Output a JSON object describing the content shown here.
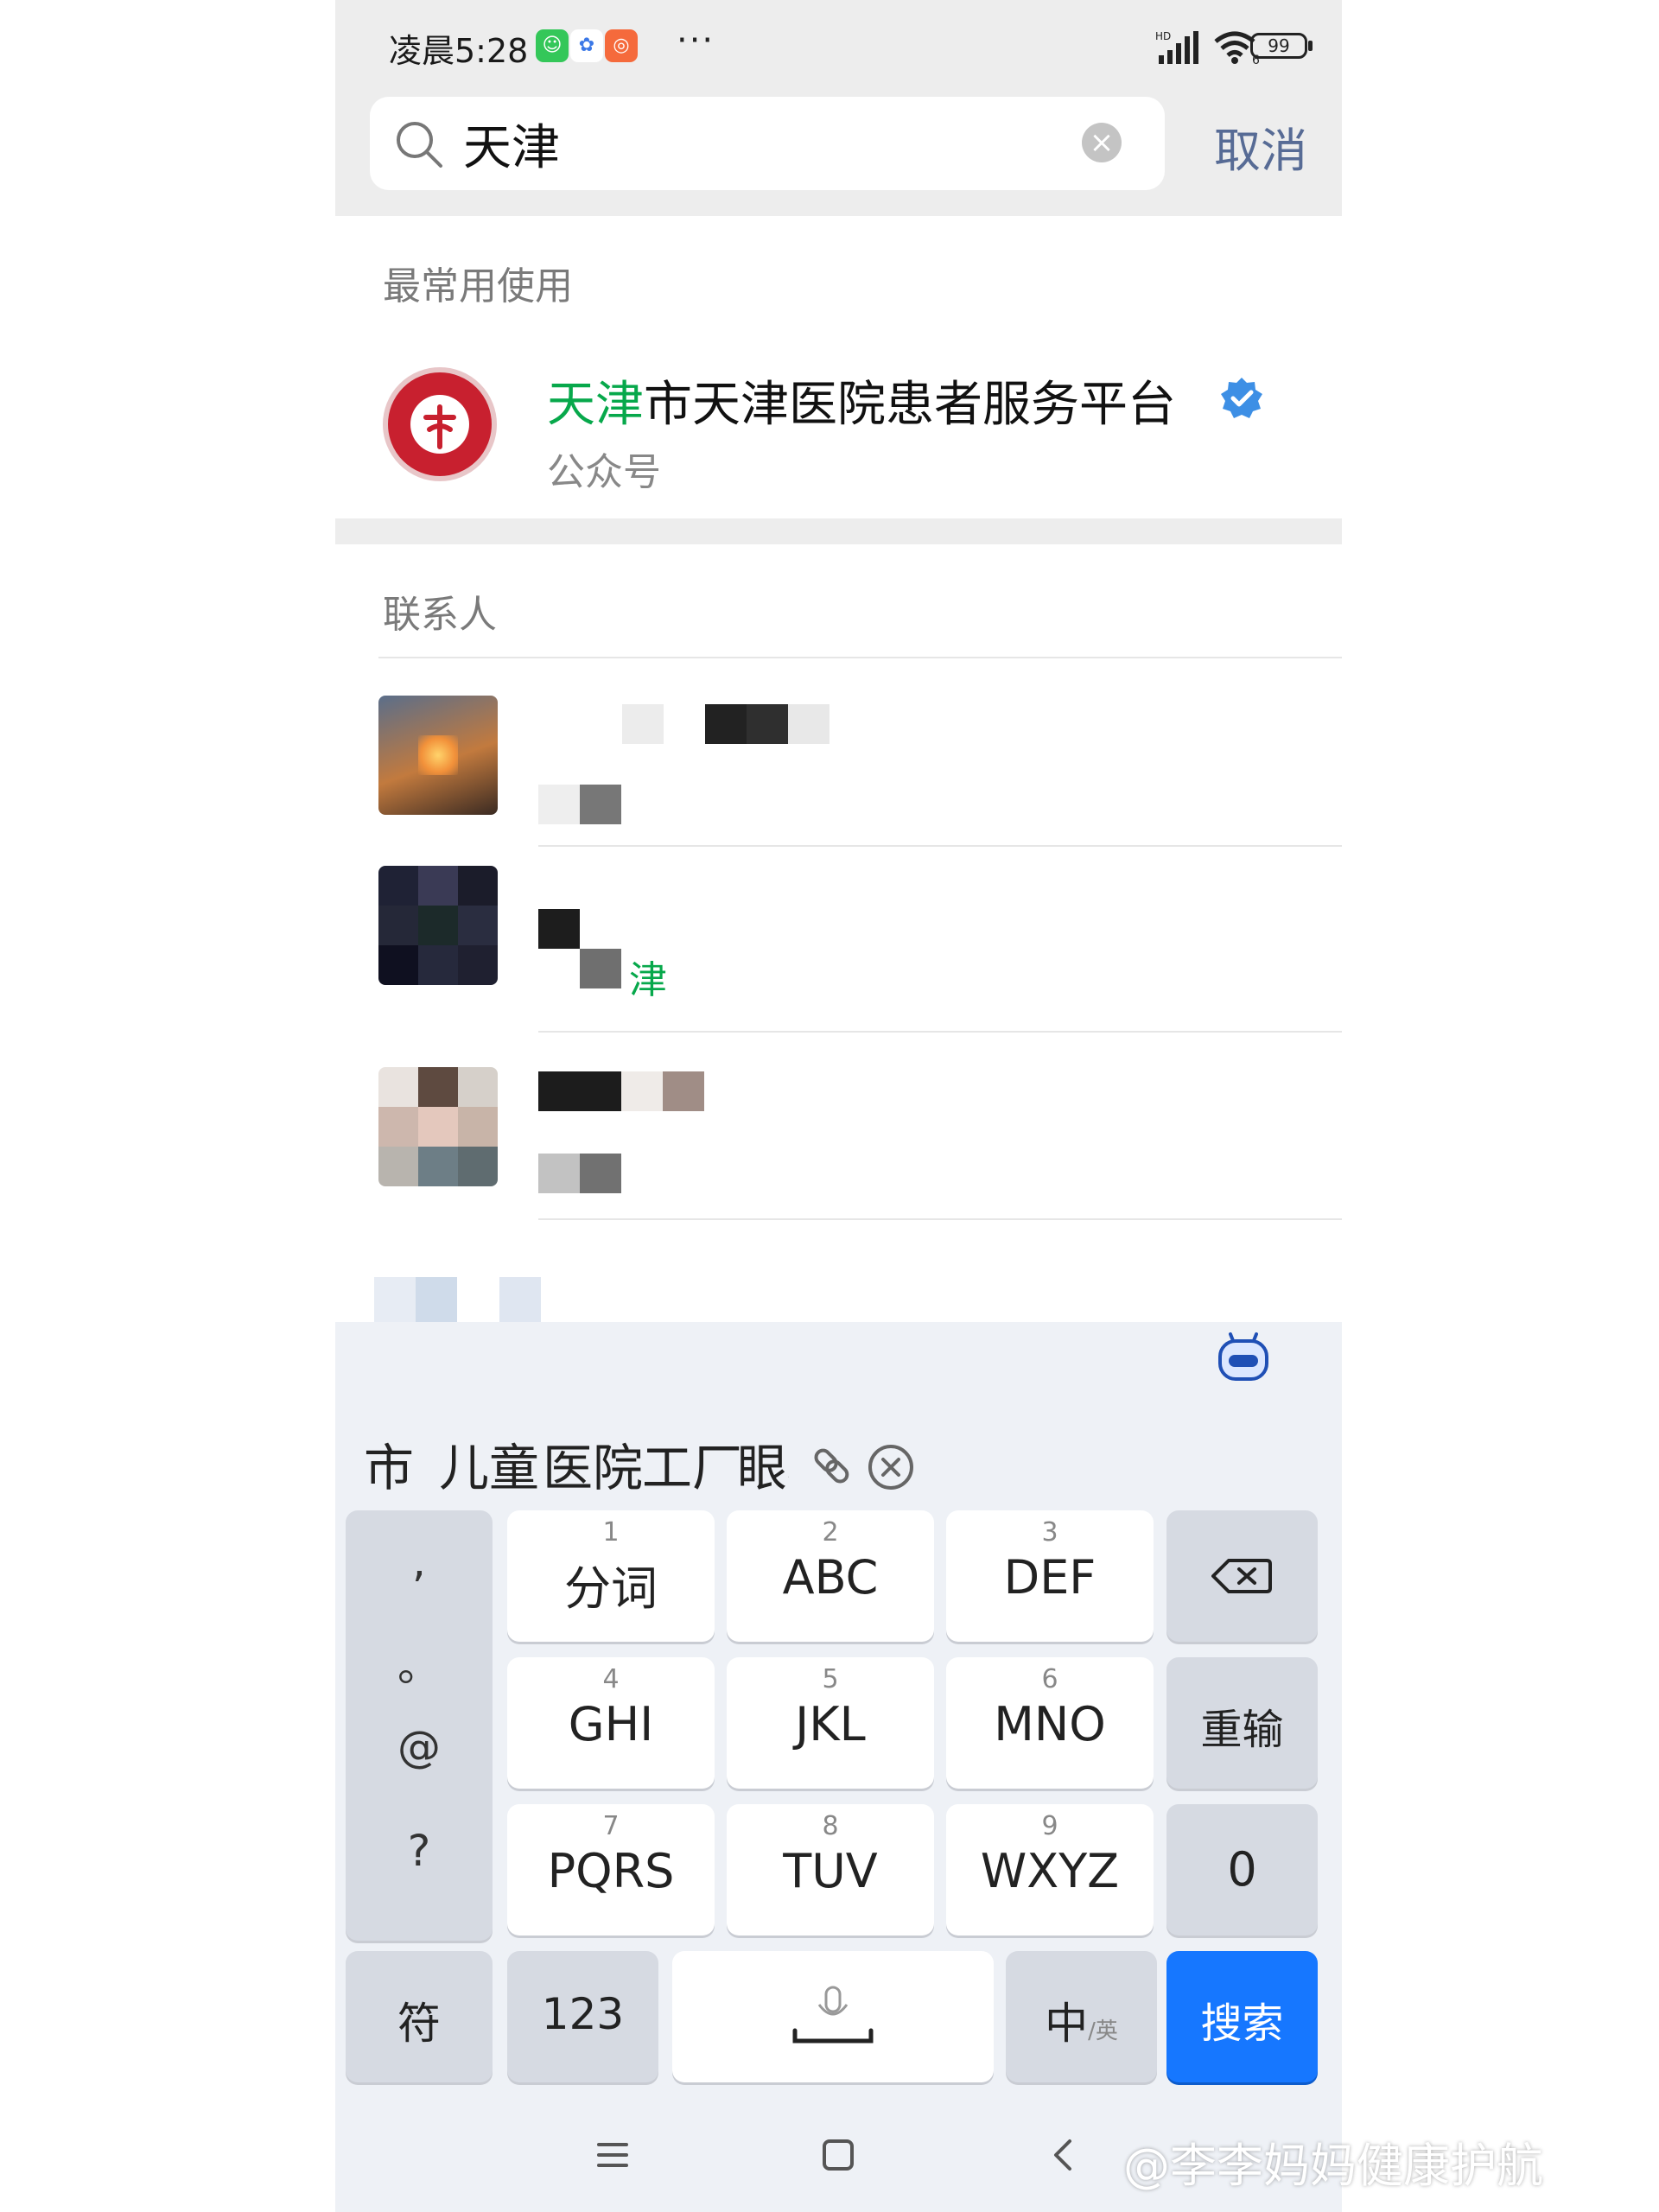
{
  "status_bar": {
    "time": "凌晨5:28",
    "network": "HD",
    "wifi_sub": "6",
    "battery": "99"
  },
  "search": {
    "query": "天津",
    "cancel_label": "取消"
  },
  "sections": {
    "most_used": "最常用使用",
    "contacts": "联系人"
  },
  "official_account": {
    "name_highlight": "天津",
    "name_rest": "市天津医院患者服务平台",
    "type": "公众号"
  },
  "contacts": [
    {
      "snippet": ""
    },
    {
      "snippet": "津"
    },
    {
      "snippet": ""
    }
  ],
  "keyboard": {
    "candidates": [
      "市",
      "儿童",
      "医院",
      "工厂",
      "眼科"
    ],
    "punct": [
      ",",
      "。",
      "@",
      "?"
    ],
    "keys": [
      {
        "num": "1",
        "label": "分词"
      },
      {
        "num": "2",
        "label": "ABC"
      },
      {
        "num": "3",
        "label": "DEF"
      },
      {
        "num": "4",
        "label": "GHI"
      },
      {
        "num": "5",
        "label": "JKL"
      },
      {
        "num": "6",
        "label": "MNO"
      },
      {
        "num": "7",
        "label": "PQRS"
      },
      {
        "num": "8",
        "label": "TUV"
      },
      {
        "num": "9",
        "label": "WXYZ"
      }
    ],
    "reenter_label": "重输",
    "zero_label": "0",
    "symbols_label": "符",
    "numbers_label": "123",
    "lang_label": "中",
    "lang_sub": "/英",
    "search_label": "搜索"
  },
  "watermark": "@李李妈妈健康护航",
  "colors": {
    "highlight": "#07a84b",
    "accent": "#1677ff",
    "cancel": "#576b95"
  }
}
